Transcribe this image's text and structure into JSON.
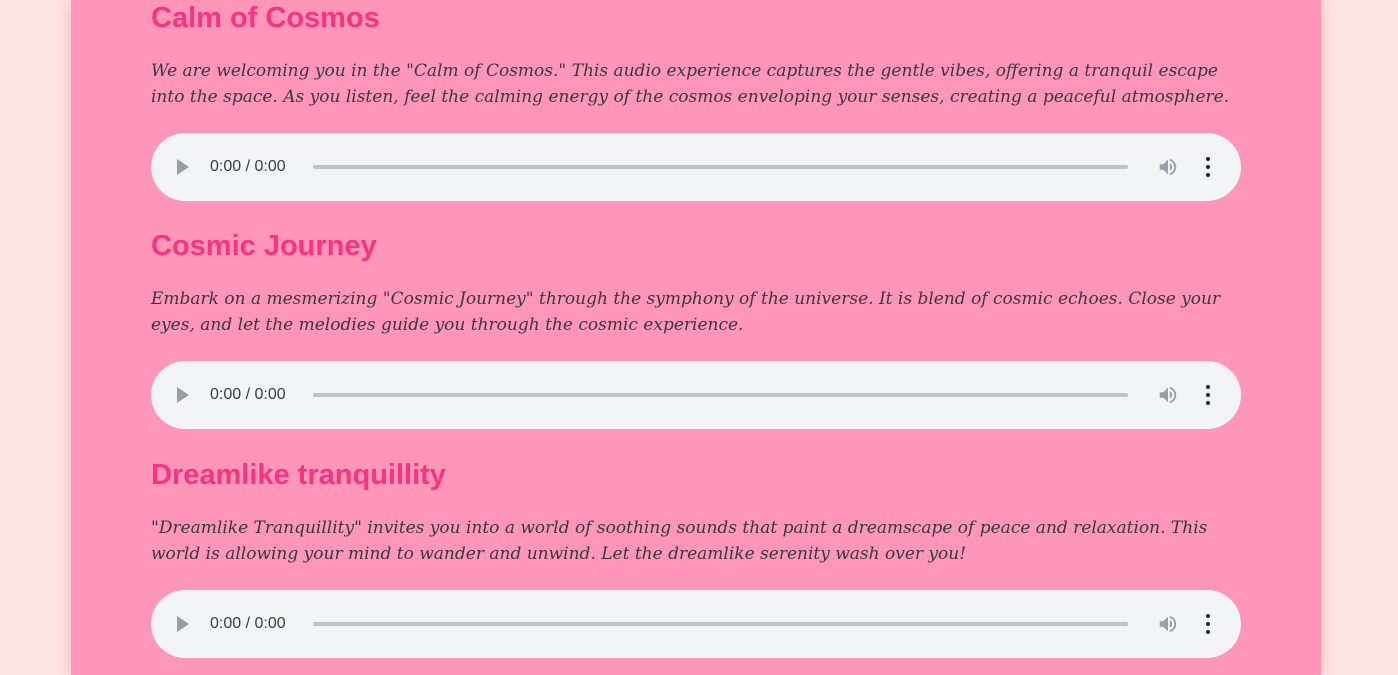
{
  "tracks": [
    {
      "title": "Calm of Cosmos",
      "description": "We are welcoming you in the \"Calm of Cosmos.\" This audio experience captures the gentle vibes, offering a tranquil escape into the space. As you listen, feel the calming energy of the cosmos enveloping your senses, creating a peaceful atmosphere.",
      "time": "0:00 / 0:00",
      "progress": 0
    },
    {
      "title": "Cosmic Journey",
      "description": "Embark on a mesmerizing \"Cosmic Journey\" through the symphony of the universe. It is blend of cosmic echoes. Close your eyes, and let the melodies guide you through the cosmic experience.",
      "time": "0:00 / 0:00",
      "progress": 0
    },
    {
      "title": "Dreamlike tranquillity",
      "description": "\"Dreamlike Tranquillity\" invites you into a world of soothing sounds that paint a dreamscape of peace and relaxation. This world is allowing your mind to wander and unwind. Let the dreamlike serenity wash over you!",
      "time": "0:00 / 0:00",
      "progress": 0
    }
  ],
  "icons": {
    "play": "play-icon",
    "volume": "volume-icon",
    "menu": "more-vert-icon"
  },
  "colors": {
    "background": "#fde2e6",
    "panel": "#ff96b9",
    "heading": "#f7347f",
    "body_text": "#333a44",
    "player": "#f1f3f4"
  }
}
